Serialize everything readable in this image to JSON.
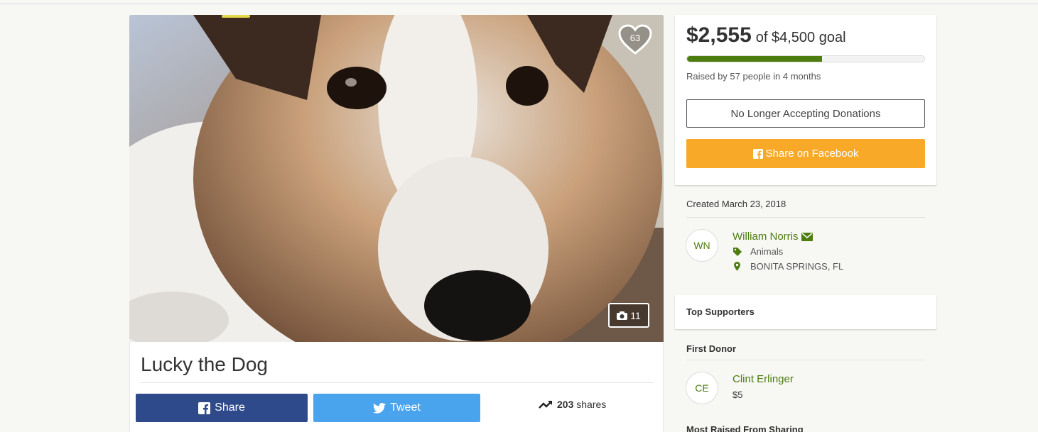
{
  "campaign": {
    "title": "Lucky the Dog",
    "hearts": "63",
    "photo_count": "11"
  },
  "social": {
    "share_label": "Share",
    "tweet_label": "Tweet",
    "shares_number": "203",
    "shares_suffix": "shares"
  },
  "donation": {
    "raised": "$2,555",
    "goal_text": "of $4,500 goal",
    "progress_fraction": 0.568,
    "raised_by": "Raised by 57 people in 4 months",
    "closed_label": "No Longer Accepting Donations",
    "facebook_label": "Share on Facebook"
  },
  "organizer": {
    "created": "Created March 23, 2018",
    "initials": "WN",
    "name": "William Norris",
    "category": "Animals",
    "location": "BONITA SPRINGS, FL"
  },
  "supporters": {
    "title": "Top Supporters",
    "first_donor_heading": "First Donor",
    "first_donor_initials": "CE",
    "first_donor_name": "Clint Erlinger",
    "first_donor_amount": "$5",
    "most_raised_heading": "Most Raised From Sharing"
  },
  "colors": {
    "accent_green": "#4d7c0f",
    "facebook_blue": "#2e4a8b",
    "twitter_blue": "#4aa3ed",
    "orange": "#f8a928"
  },
  "icons": {
    "heart": "heart-icon",
    "camera": "camera-icon",
    "facebook": "facebook-icon",
    "twitter": "twitter-icon",
    "trending": "trending-up-icon",
    "envelope": "envelope-icon",
    "tag": "tag-icon",
    "location": "map-marker-icon"
  }
}
